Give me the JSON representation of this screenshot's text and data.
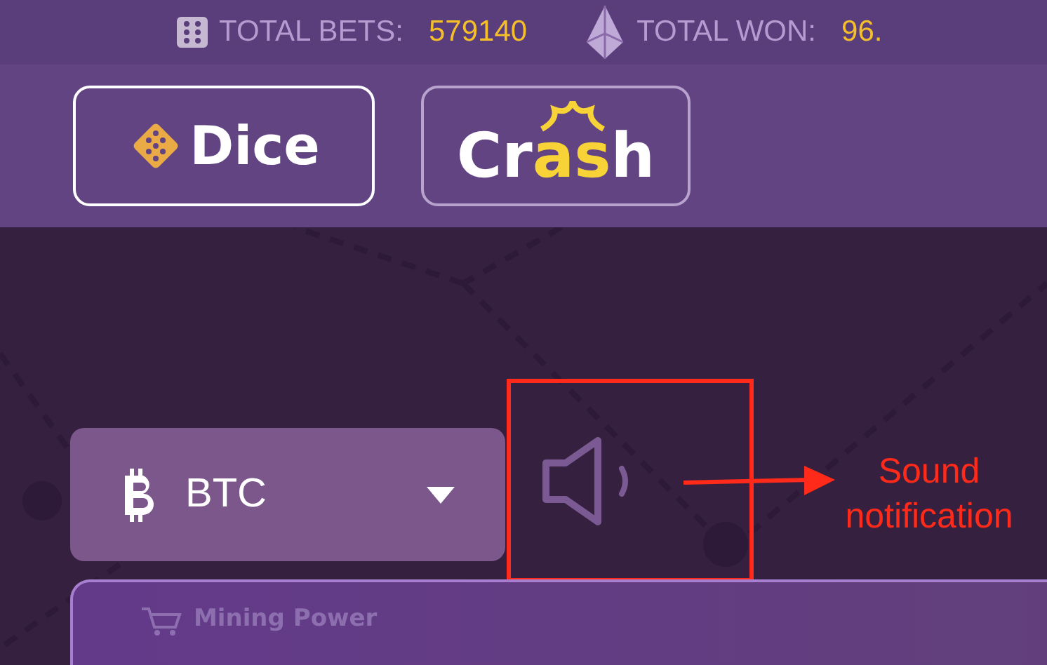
{
  "stats_bar": {
    "stats": [
      {
        "kind": "dice",
        "label": "TOTAL BETS:",
        "value": "579140"
      },
      {
        "kind": "crystal",
        "label": "TOTAL WON:",
        "value": "96."
      }
    ]
  },
  "game_tabs": [
    {
      "kind": "dice",
      "parts": [
        {
          "text": "Dice",
          "highlight": false
        }
      ],
      "selected": true
    },
    {
      "kind": "crash",
      "parts": [
        {
          "text": "Cr",
          "highlight": false
        },
        {
          "text": "as",
          "highlight": true
        },
        {
          "text": "h",
          "highlight": false
        }
      ],
      "selected": false
    }
  ],
  "currency_select": {
    "value": "BTC"
  },
  "annotation": {
    "text": "Sound notification"
  },
  "card": {
    "title": "Mining Power"
  }
}
